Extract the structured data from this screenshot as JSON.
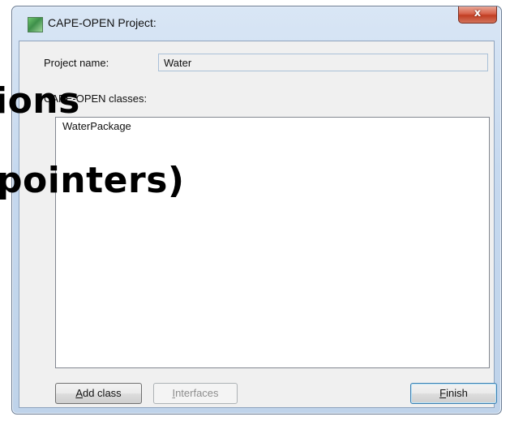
{
  "window": {
    "title": "CAPE-OPEN Project:",
    "close_glyph": "x"
  },
  "form": {
    "project_name_label": "Project name:",
    "project_name_value": "Water",
    "classes_label": "CAPE-OPEN classes:",
    "classes": [
      "WaterPackage"
    ]
  },
  "buttons": {
    "add_class_hotkey": "A",
    "add_class_rest": "dd class",
    "interfaces_hotkey": "I",
    "interfaces_rest": "nterfaces",
    "finish_hotkey": "F",
    "finish_rest": "inish"
  },
  "overlay": {
    "line1": "ions",
    "line2": "pointers)"
  },
  "icons": {
    "app": "cape-open-app-icon",
    "close": "close-icon"
  }
}
